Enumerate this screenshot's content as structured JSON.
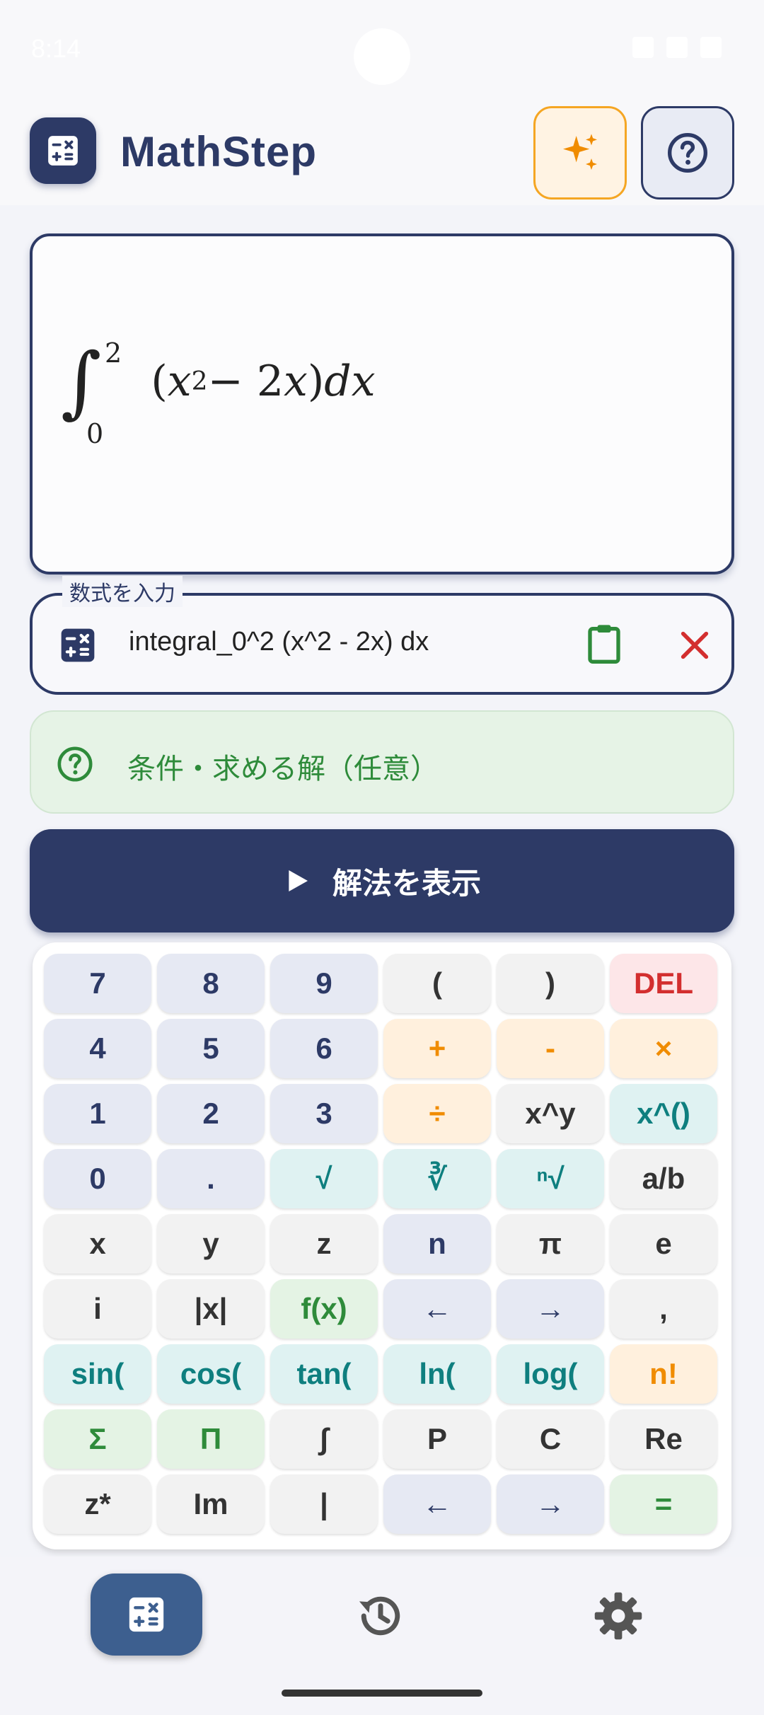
{
  "status_bar": {
    "time": "8:14"
  },
  "app_bar": {
    "title": "MathStep"
  },
  "preview": {
    "integral_symbol": "∫",
    "upper_limit": "2",
    "lower_limit": "0",
    "lparen": "(",
    "x1": "x",
    "exp": "2",
    "minus": " − 2",
    "x2": "x",
    "rparen": ")",
    "dx": " dx"
  },
  "input": {
    "label": "数式を入力",
    "value": "integral_0^2 (x^2 - 2x) dx"
  },
  "conditions": {
    "label": "条件・求める解（任意）"
  },
  "solve_button": {
    "label": "解法を表示"
  },
  "keypad": {
    "rows": [
      [
        "7",
        "8",
        "9",
        "(",
        ")",
        "DEL"
      ],
      [
        "4",
        "5",
        "6",
        "+",
        "-",
        "×"
      ],
      [
        "1",
        "2",
        "3",
        "÷",
        "x^y",
        "x^()"
      ],
      [
        "0",
        ".",
        "√",
        "∛",
        "ⁿ√",
        "a/b"
      ],
      [
        "x",
        "y",
        "z",
        "n",
        "π",
        "e"
      ],
      [
        "i",
        "|x|",
        "f(x)",
        "←",
        "→",
        ","
      ],
      [
        "sin(",
        "cos(",
        "tan(",
        "ln(",
        "log(",
        "n!"
      ],
      [
        "Σ",
        "Π",
        "∫",
        "P",
        "C",
        "Re"
      ],
      [
        "z*",
        "Im",
        "|",
        "←",
        "→",
        "="
      ]
    ]
  },
  "colors": {
    "primary": "#2d3a66",
    "accent_orange": "#f5a623",
    "success_green": "#2e8b3a",
    "danger_red": "#d32f2f",
    "teal": "#0e7f7f"
  },
  "icons": {
    "app_logo": "calculator-icon",
    "ai": "sparkle-icon",
    "help": "help-circle-icon",
    "input_leading": "calculator-icon",
    "paste": "clipboard-icon",
    "clear": "close-icon",
    "conditions": "help-circle-icon",
    "solve": "play-icon",
    "nav_calculator": "calculator-icon",
    "nav_history": "history-icon",
    "nav_settings": "gear-icon"
  }
}
